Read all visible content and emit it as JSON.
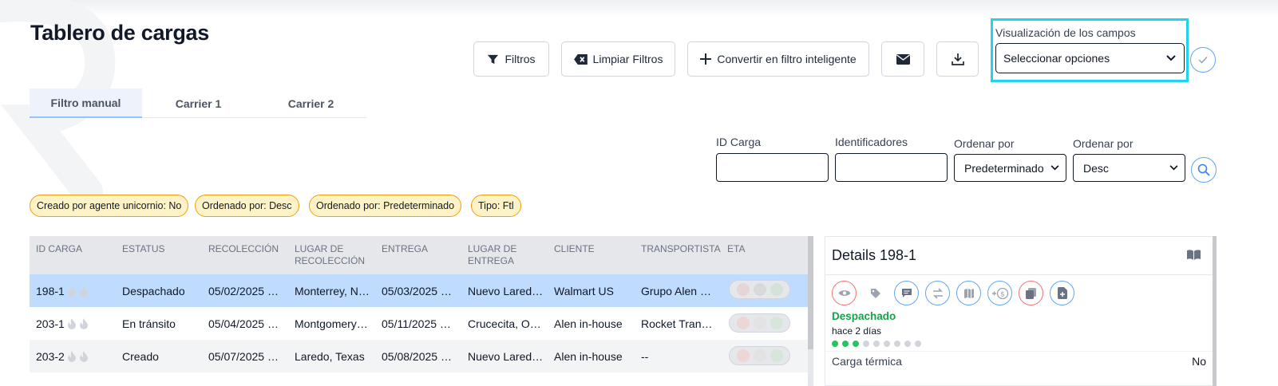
{
  "page": {
    "title": "Tablero de cargas"
  },
  "toolbar": {
    "filters": "Filtros",
    "clear_filters": "Limpiar Filtros",
    "convert_smart": "Convertir en filtro inteligente"
  },
  "field_visibility": {
    "label": "Visualización de los campos",
    "placeholder": "Seleccionar opciones"
  },
  "tabs": [
    {
      "label": "Filtro manual",
      "active": true
    },
    {
      "label": "Carrier 1",
      "active": false
    },
    {
      "label": "Carrier 2",
      "active": false
    }
  ],
  "search": {
    "id_label": "ID Carga",
    "identifiers_label": "Identificadores",
    "order_by_label": "Ordenar por",
    "order_by_value": "Predeterminado",
    "order_dir_label": "Ordenar por",
    "order_dir_value": "Desc"
  },
  "chips": [
    "Creado por agente unicornio: No",
    "Ordenado por: Desc",
    "Ordenado por: Predeterminado",
    "Tipo: Ftl"
  ],
  "table": {
    "headers": [
      "ID CARGA",
      "ESTATUS",
      "RECOLECCIÓN",
      "LUGAR DE RECOLECCIÓN",
      "ENTREGA",
      "LUGAR DE ENTREGA",
      "CLIENTE",
      "TRANSPORTISTA",
      "ETA"
    ],
    "rows": [
      {
        "id": "198-1",
        "status": "Despachado",
        "pickup": "05/02/2025 …",
        "pickup_place": "Monterrey, N…",
        "delivery": "05/03/2025 …",
        "delivery_place": "Nuevo Lared…",
        "client": "Walmart US",
        "carrier": "Grupo Alen …",
        "selected": true
      },
      {
        "id": "203-1",
        "status": "En tránsito",
        "pickup": "05/04/2025 …",
        "pickup_place": "Montgomery…",
        "delivery": "05/11/2025 …",
        "delivery_place": "Crucecita, O…",
        "client": "Alen in-house",
        "carrier": "Rocket Tran…",
        "selected": false
      },
      {
        "id": "203-2",
        "status": "Creado",
        "pickup": "05/07/2025 …",
        "pickup_place": "Laredo, Texas",
        "delivery": "05/08/2025 …",
        "delivery_place": "Nuevo Lared…",
        "client": "Alen in-house",
        "carrier": "--",
        "selected": false
      }
    ]
  },
  "details": {
    "title": "Details 198-1",
    "status": "Despachado",
    "status_time": "hace 2 días",
    "progress_steps_done": 3,
    "progress_steps_total": 9,
    "field_key": "Carga térmica",
    "field_value": "No"
  },
  "colors": {
    "accent_cyan": "#22d3ee",
    "selected_row": "#bfdbfe",
    "chip_bg": "#fef3c7",
    "chip_border": "#f59e0b",
    "status_green": "#16a34a"
  }
}
